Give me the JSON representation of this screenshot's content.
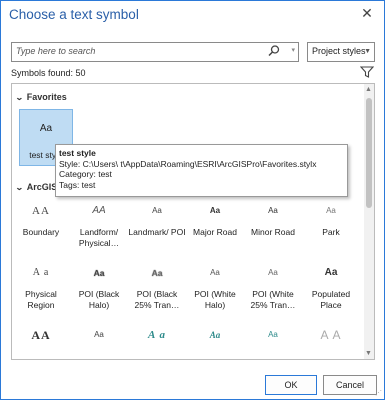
{
  "dialog": {
    "title": "Choose a text symbol",
    "close_glyph": "✕"
  },
  "search": {
    "placeholder": "Type here to search"
  },
  "styles_dropdown": {
    "selected": "Project styles"
  },
  "symbols_found": "Symbols found: 50",
  "groups": {
    "favorites": "Favorites",
    "arcgis": "ArcGIS"
  },
  "favorites": [
    {
      "swatch": "Aa",
      "name": "test style"
    }
  ],
  "tooltip": {
    "title": "test style",
    "style_line": "Style: C:\\Users\\            t\\AppData\\Roaming\\ESRI\\ArcGISPro\\Favorites.stylx",
    "category_line": "Category: test",
    "tags_line": "Tags: test"
  },
  "symbols": [
    {
      "swatch": "AA",
      "label": "Boundary",
      "color": "#444",
      "style": "serif-cap"
    },
    {
      "swatch": "AA",
      "label": "Landform/ Physical…",
      "color": "#555",
      "style": "italic"
    },
    {
      "swatch": "Aa",
      "label": "Landmark/ POI",
      "color": "#444",
      "style": "small"
    },
    {
      "swatch": "Aa",
      "label": "Major Road",
      "color": "#333",
      "style": "bold-small"
    },
    {
      "swatch": "Aa",
      "label": "Minor Road",
      "color": "#333",
      "style": "small"
    },
    {
      "swatch": "Aa",
      "label": "Park",
      "color": "#777",
      "style": "small"
    },
    {
      "swatch": "A a",
      "label": "Physical Region",
      "color": "#444",
      "style": "serif"
    },
    {
      "swatch": "Aa",
      "label": "POI (Black Halo)",
      "color": "#444",
      "style": "halo"
    },
    {
      "swatch": "Aa",
      "label": "POI (Black 25% Tran…",
      "color": "#666",
      "style": "halo"
    },
    {
      "swatch": "Aa",
      "label": "POI (White Halo)",
      "color": "#555",
      "style": "small"
    },
    {
      "swatch": "Aa",
      "label": "POI (White 25% Tran…",
      "color": "#666",
      "style": "small"
    },
    {
      "swatch": "Aa",
      "label": "Populated Place",
      "color": "#333",
      "style": "bold"
    },
    {
      "swatch": "AA",
      "label": "",
      "color": "#333",
      "style": "serif-cap-big"
    },
    {
      "swatch": "Aa",
      "label": "",
      "color": "#444",
      "style": "small"
    },
    {
      "swatch": "A a",
      "label": "",
      "color": "#2e8b8b",
      "style": "serif-italic"
    },
    {
      "swatch": "Aa",
      "label": "",
      "color": "#2e8b8b",
      "style": "italic-small"
    },
    {
      "swatch": "Aa",
      "label": "",
      "color": "#2e8b8b",
      "style": "small"
    },
    {
      "swatch": "A A",
      "label": "",
      "color": "#aaa",
      "style": "sans-big"
    }
  ],
  "buttons": {
    "ok": "OK",
    "cancel": "Cancel"
  }
}
